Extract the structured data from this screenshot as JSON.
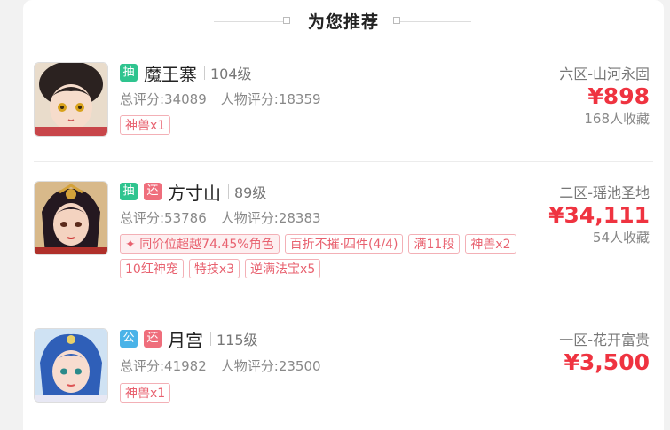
{
  "header": {
    "title": "为您推荐"
  },
  "items": [
    {
      "tags": [
        {
          "text": "抽",
          "color": "#2fc48f"
        }
      ],
      "name": "魔王寨",
      "level": "104级",
      "total_score": "总评分:34089",
      "char_score": "人物评分:18359",
      "chips": [
        "神兽x1"
      ],
      "server": "六区-山河永固",
      "price": "¥898",
      "favorites": "168人收藏"
    },
    {
      "tags": [
        {
          "text": "抽",
          "color": "#2fc48f"
        },
        {
          "text": "还",
          "color": "#ef6e7c"
        }
      ],
      "name": "方寸山",
      "level": "89级",
      "total_score": "总评分:53786",
      "char_score": "人物评分:28383",
      "highlight_chip": "同价位超越74.45%角色",
      "chips": [
        "百折不摧·四件(4/4)",
        "满11段",
        "神兽x2",
        "10红神宠",
        "特技x3",
        "逆满法宝x5"
      ],
      "server": "二区-瑶池圣地",
      "price": "¥34,111",
      "favorites": "54人收藏"
    },
    {
      "tags": [
        {
          "text": "公",
          "color": "#4ab3e8"
        },
        {
          "text": "还",
          "color": "#ef6e7c"
        }
      ],
      "name": "月宫",
      "level": "115级",
      "total_score": "总评分:41982",
      "char_score": "人物评分:23500",
      "chips": [
        "神兽x1"
      ],
      "server": "一区-花开富贵",
      "price": "¥3,500"
    }
  ]
}
